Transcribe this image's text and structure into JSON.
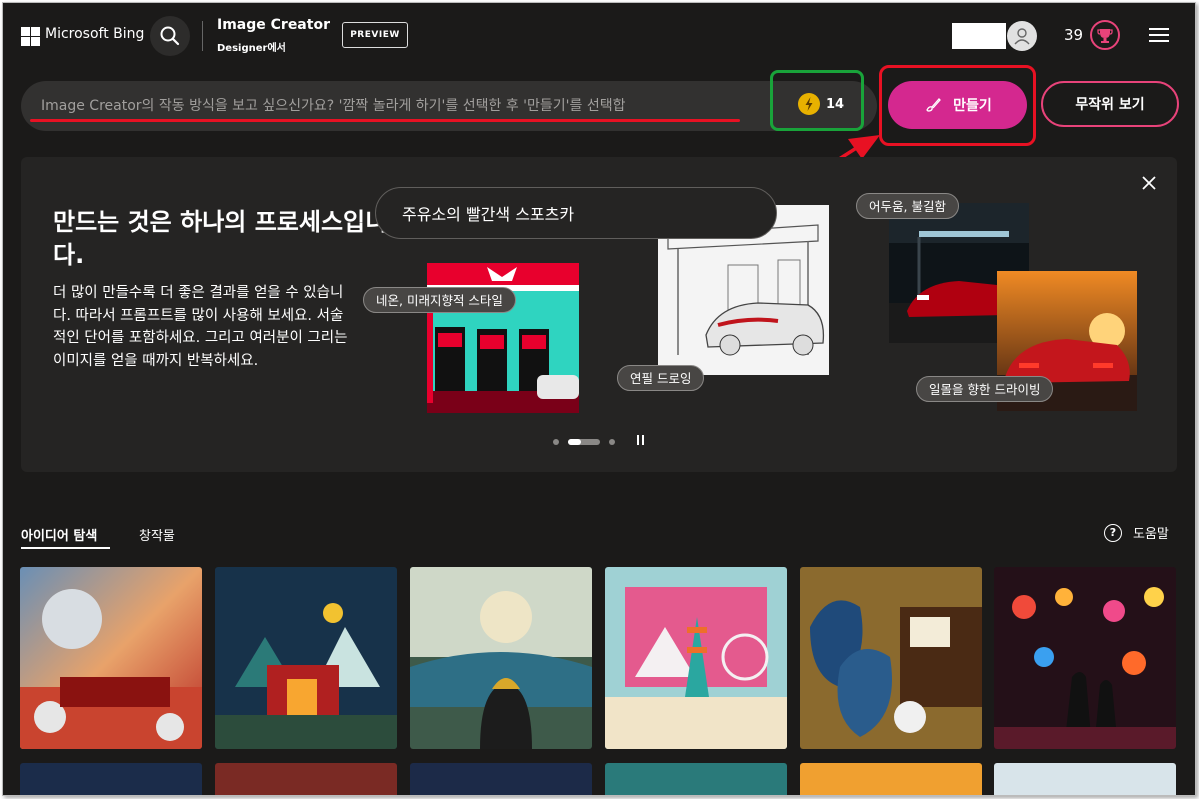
{
  "header": {
    "brand": "Microsoft Bing",
    "title": "Image Creator",
    "subtitle": "Designer에서",
    "preview_label": "PREVIEW",
    "rewards_count": "39"
  },
  "prompt": {
    "placeholder": "Image Creator의 작동 방식을 보고 싶으신가요? '깜짝 놀라게 하기'를 선택한 후 '만들기'를 선택합",
    "boosts_count": "14",
    "create_label": "만들기",
    "surprise_label": "무작위 보기"
  },
  "hero": {
    "title": "만드는 것은 하나의 프로세스입니다.",
    "description": "더 많이 만들수록 더 좋은 결과를 얻을 수 있습니다. 따라서 프롬프트를 많이 사용해 보세요. 서술적인 단어를 포함하세요. 그리고 여러분이 그리는 이미지를 얻을 때까지 반복하세요.",
    "sample_prompt": "주유소의 빨간색 스포츠카",
    "chips": [
      "네온, 미래지향적 스타일",
      "연필 드로잉",
      "어두움, 불길함",
      "일몰을 향한 드라이빙"
    ]
  },
  "tabs": {
    "ideas": "아이디어 탐색",
    "creations": "창작물",
    "help": "도움말"
  },
  "colors": {
    "background": "#1b1a19",
    "accent_pink": "#d4288f",
    "highlight_red": "#e81123",
    "highlight_green": "#19a33a"
  }
}
